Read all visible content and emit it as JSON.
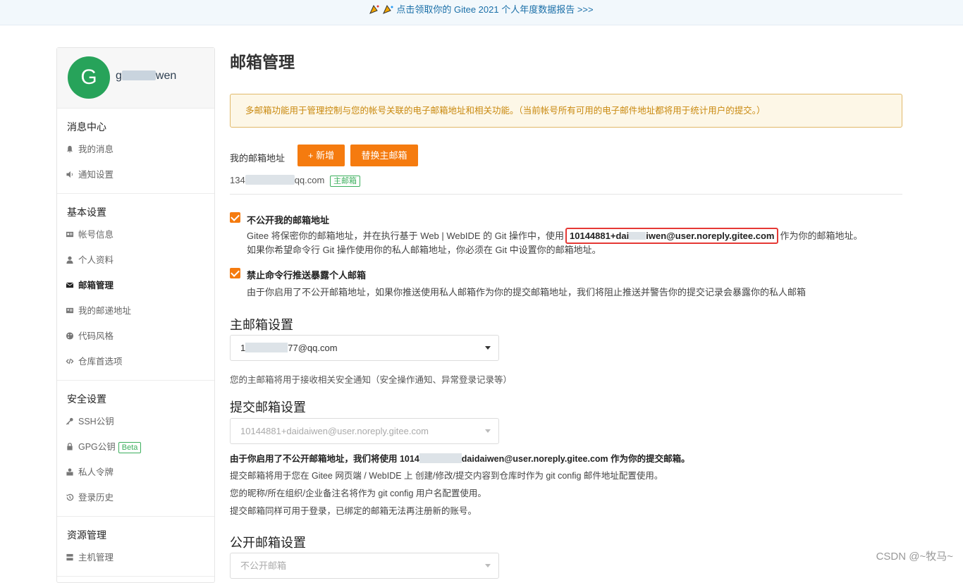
{
  "banner": {
    "text": "点击领取你的 Gitee 2021 个人年度数据报告 >>>"
  },
  "profile": {
    "avatar_letter": "G",
    "name_prefix": "g",
    "name_suffix": "wen"
  },
  "sidebar": {
    "sections": [
      {
        "title": "消息中心",
        "items": [
          {
            "label": "我的消息",
            "icon": "bell-icon"
          },
          {
            "label": "通知设置",
            "icon": "speaker-icon"
          }
        ]
      },
      {
        "title": "基本设置",
        "items": [
          {
            "label": "帐号信息",
            "icon": "id-card-icon"
          },
          {
            "label": "个人资料",
            "icon": "user-icon"
          },
          {
            "label": "邮箱管理",
            "icon": "envelope-icon",
            "active": true
          },
          {
            "label": "我的邮递地址",
            "icon": "address-card-icon"
          },
          {
            "label": "代码风格",
            "icon": "palette-icon"
          },
          {
            "label": "仓库首选项",
            "icon": "code-icon"
          }
        ]
      },
      {
        "title": "安全设置",
        "items": [
          {
            "label": "SSH公钥",
            "icon": "key-icon"
          },
          {
            "label": "GPG公钥",
            "icon": "lock-icon",
            "badge": "Beta"
          },
          {
            "label": "私人令牌",
            "icon": "token-icon"
          },
          {
            "label": "登录历史",
            "icon": "history-icon"
          }
        ]
      },
      {
        "title": "资源管理",
        "items": [
          {
            "label": "主机管理",
            "icon": "server-icon"
          }
        ]
      }
    ]
  },
  "main": {
    "title": "邮箱管理",
    "notice": "多邮箱功能用于管理控制与您的帐号关联的电子邮箱地址和相关功能。（当前帐号所有可用的电子邮件地址都将用于统计用户的提交。）",
    "my_email_label": "我的邮箱地址",
    "add_button": "+ 新增",
    "swap_button": "替换主邮箱",
    "email_prefix": "134",
    "email_suffix": "qq.com",
    "primary_badge": "主邮箱",
    "opt1": {
      "title": "不公开我的邮箱地址",
      "desc_before": "Gitee 将保密你的邮箱地址，并在执行基于 Web | WebIDE 的 Git 操作中，使用",
      "highlight_prefix": "10144881+dai",
      "highlight_suffix": "iwen@user.noreply.gitee.com",
      "desc_after": "作为你的邮箱地址。",
      "desc_line2": "如果你希望命令行 Git 操作使用你的私人邮箱地址，你必须在 Git 中设置你的邮箱地址。"
    },
    "opt2": {
      "title": "禁止命令行推送暴露个人邮箱",
      "desc": "由于你启用了不公开邮箱地址，如果你推送使用私人邮箱作为你的提交邮箱地址，我们将阻止推送并警告你的提交记录会暴露你的私人邮箱"
    },
    "primary_settings": {
      "title": "主邮箱设置",
      "selected_prefix": "1",
      "selected_suffix": "77@qq.com",
      "note": "您的主邮箱将用于接收相关安全通知（安全操作通知、异常登录记录等）"
    },
    "commit_settings": {
      "title": "提交邮箱设置",
      "selected": "10144881+daidaiwen@user.noreply.gitee.com",
      "line1_before": "由于你启用了不公开邮箱地址，我们将使用 1014",
      "line1_after": "daidaiwen@user.noreply.gitee.com 作为你的提交邮箱。",
      "line2": "提交邮箱将用于您在 Gitee 网页端 / WebIDE 上 创建/修改/提交内容到仓库时作为 git config 邮件地址配置使用。",
      "line3": "您的昵称/所在组织/企业备注名将作为 git config 用户名配置使用。",
      "line4": "提交邮箱同样可用于登录，已绑定的邮箱无法再注册新的账号。"
    },
    "public_settings": {
      "title": "公开邮箱设置",
      "selected": "不公开邮箱"
    }
  },
  "watermark": "CSDN @~牧马~",
  "colors": {
    "accent": "#f57b0f",
    "green": "#3caf5d",
    "link": "#1a6fa8",
    "highlight_border": "#e53935"
  }
}
